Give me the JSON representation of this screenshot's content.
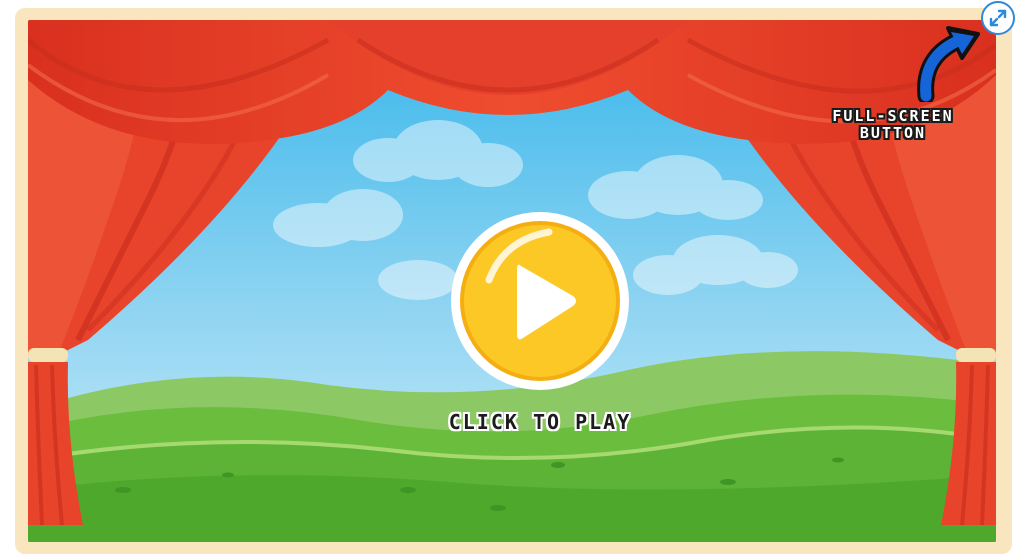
{
  "game": {
    "play_prompt": "CLICK TO PLAY",
    "annotation": {
      "line1": "FULL-SCREEN",
      "line2": "BUTTON"
    }
  },
  "icons": {
    "play": "play-triangle-icon",
    "fullscreen": "expand-arrows-icon",
    "pointer": "curved-arrow-icon"
  },
  "colors": {
    "frame": "#f9e6bf",
    "curtain": "#e8432b",
    "sky": "#6cc3ec",
    "grass": "#5cb336",
    "play_button": "#fcc826",
    "fullscreen_ring": "#2f89d8",
    "pointer_arrow": "#1565d8"
  }
}
